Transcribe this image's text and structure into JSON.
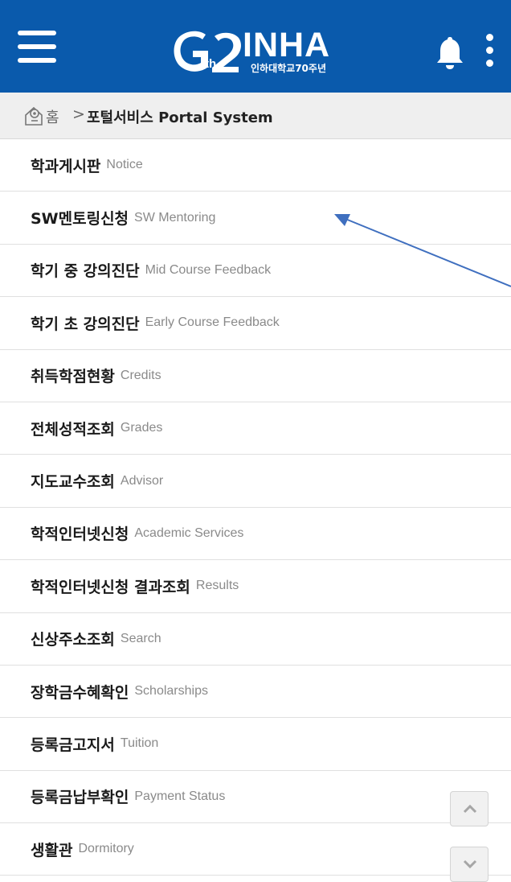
{
  "header": {
    "logo_main": "INHA",
    "logo_sub": "인하대학교70주년",
    "logo_th": "th",
    "brand_color": "#0a5aac"
  },
  "breadcrumb": {
    "home": "홈",
    "separator": ">",
    "current": "포털서비스 Portal System"
  },
  "menu": [
    {
      "ko": "학과게시판",
      "en": "Notice"
    },
    {
      "ko": "SW멘토링신청",
      "en": "SW Mentoring"
    },
    {
      "ko": "학기 중 강의진단",
      "en": "Mid Course Feedback"
    },
    {
      "ko": "학기 초 강의진단",
      "en": "Early Course Feedback"
    },
    {
      "ko": "취득학점현황",
      "en": "Credits"
    },
    {
      "ko": "전체성적조회",
      "en": "Grades"
    },
    {
      "ko": "지도교수조회",
      "en": "Advisor"
    },
    {
      "ko": "학적인터넷신청",
      "en": "Academic Services"
    },
    {
      "ko": "학적인터넷신청 결과조회",
      "en": "Results"
    },
    {
      "ko": "신상주소조회",
      "en": "Search"
    },
    {
      "ko": "장학금수혜확인",
      "en": "Scholarships"
    },
    {
      "ko": "등록금고지서",
      "en": "Tuition"
    },
    {
      "ko": "등록금납부확인",
      "en": "Payment Status"
    },
    {
      "ko": "생활관",
      "en": "Dormitory"
    }
  ],
  "icons": {
    "menu": "hamburger-icon",
    "notifications": "bell-icon",
    "more": "kebab-icon",
    "home": "home-location-icon",
    "scroll_up": "chevron-up-icon",
    "scroll_down": "chevron-down-icon"
  },
  "annotation_color": "#3f6fbf"
}
